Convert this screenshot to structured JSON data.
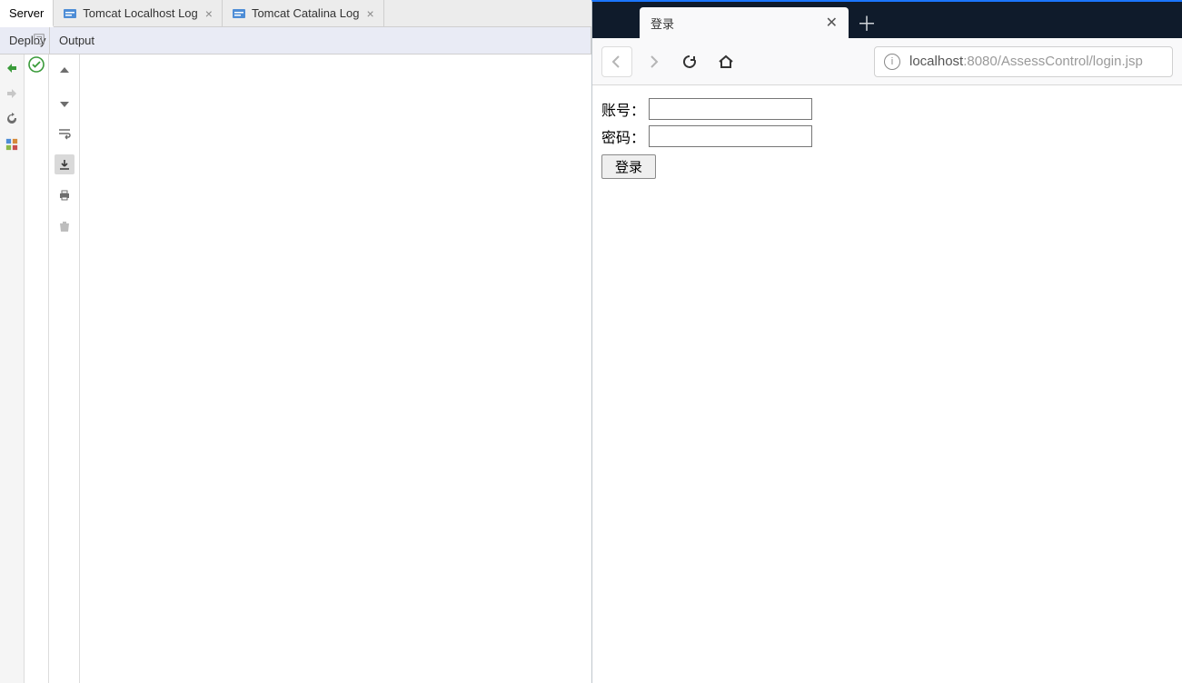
{
  "ide": {
    "tabs": {
      "server": "Server",
      "localhost_log": "Tomcat Localhost Log",
      "catalina_log": "Tomcat Catalina Log"
    },
    "subtabs": {
      "deploy": "Deploy",
      "output": "Output"
    }
  },
  "browser": {
    "tab_title": "登录",
    "url_host": "localhost",
    "url_port_path": ":8080/AssessControl/login.jsp"
  },
  "page": {
    "account_label": "账号：",
    "password_label": "密码：",
    "login_button": "登录"
  }
}
